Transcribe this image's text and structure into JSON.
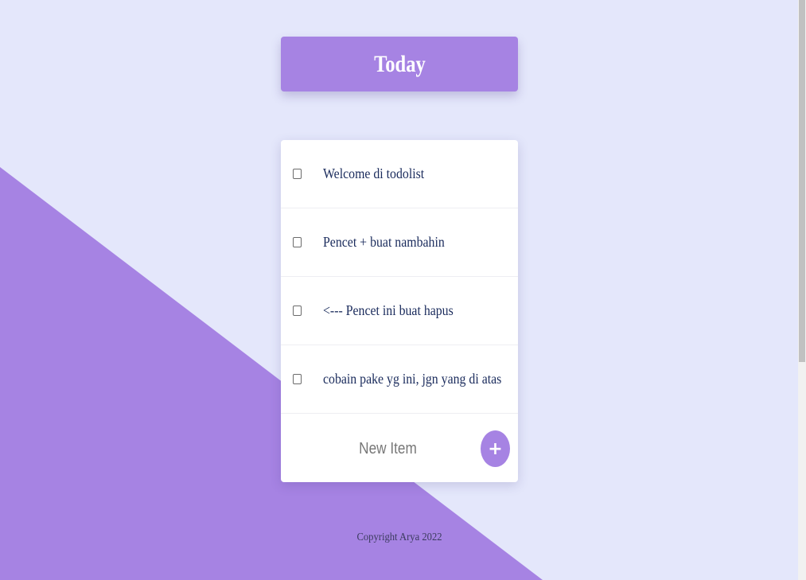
{
  "colors": {
    "background": "#e4e7fb",
    "accent": "#a683e3",
    "item_text": "#1a2b5c"
  },
  "heading": {
    "title": "Today"
  },
  "todo": {
    "items": [
      {
        "label": "Welcome di todolist",
        "checked": false
      },
      {
        "label": "Pencet + buat nambahin",
        "checked": false
      },
      {
        "label": "<--- Pencet ini buat hapus",
        "checked": false
      },
      {
        "label": "cobain pake yg ini, jgn yang di atas",
        "checked": false
      }
    ],
    "new_item": {
      "placeholder": "New Item",
      "value": ""
    },
    "add_button_label": "+",
    "add_button_icon": "plus-icon"
  },
  "footer": {
    "copyright": "Copyright Arya 2022"
  }
}
